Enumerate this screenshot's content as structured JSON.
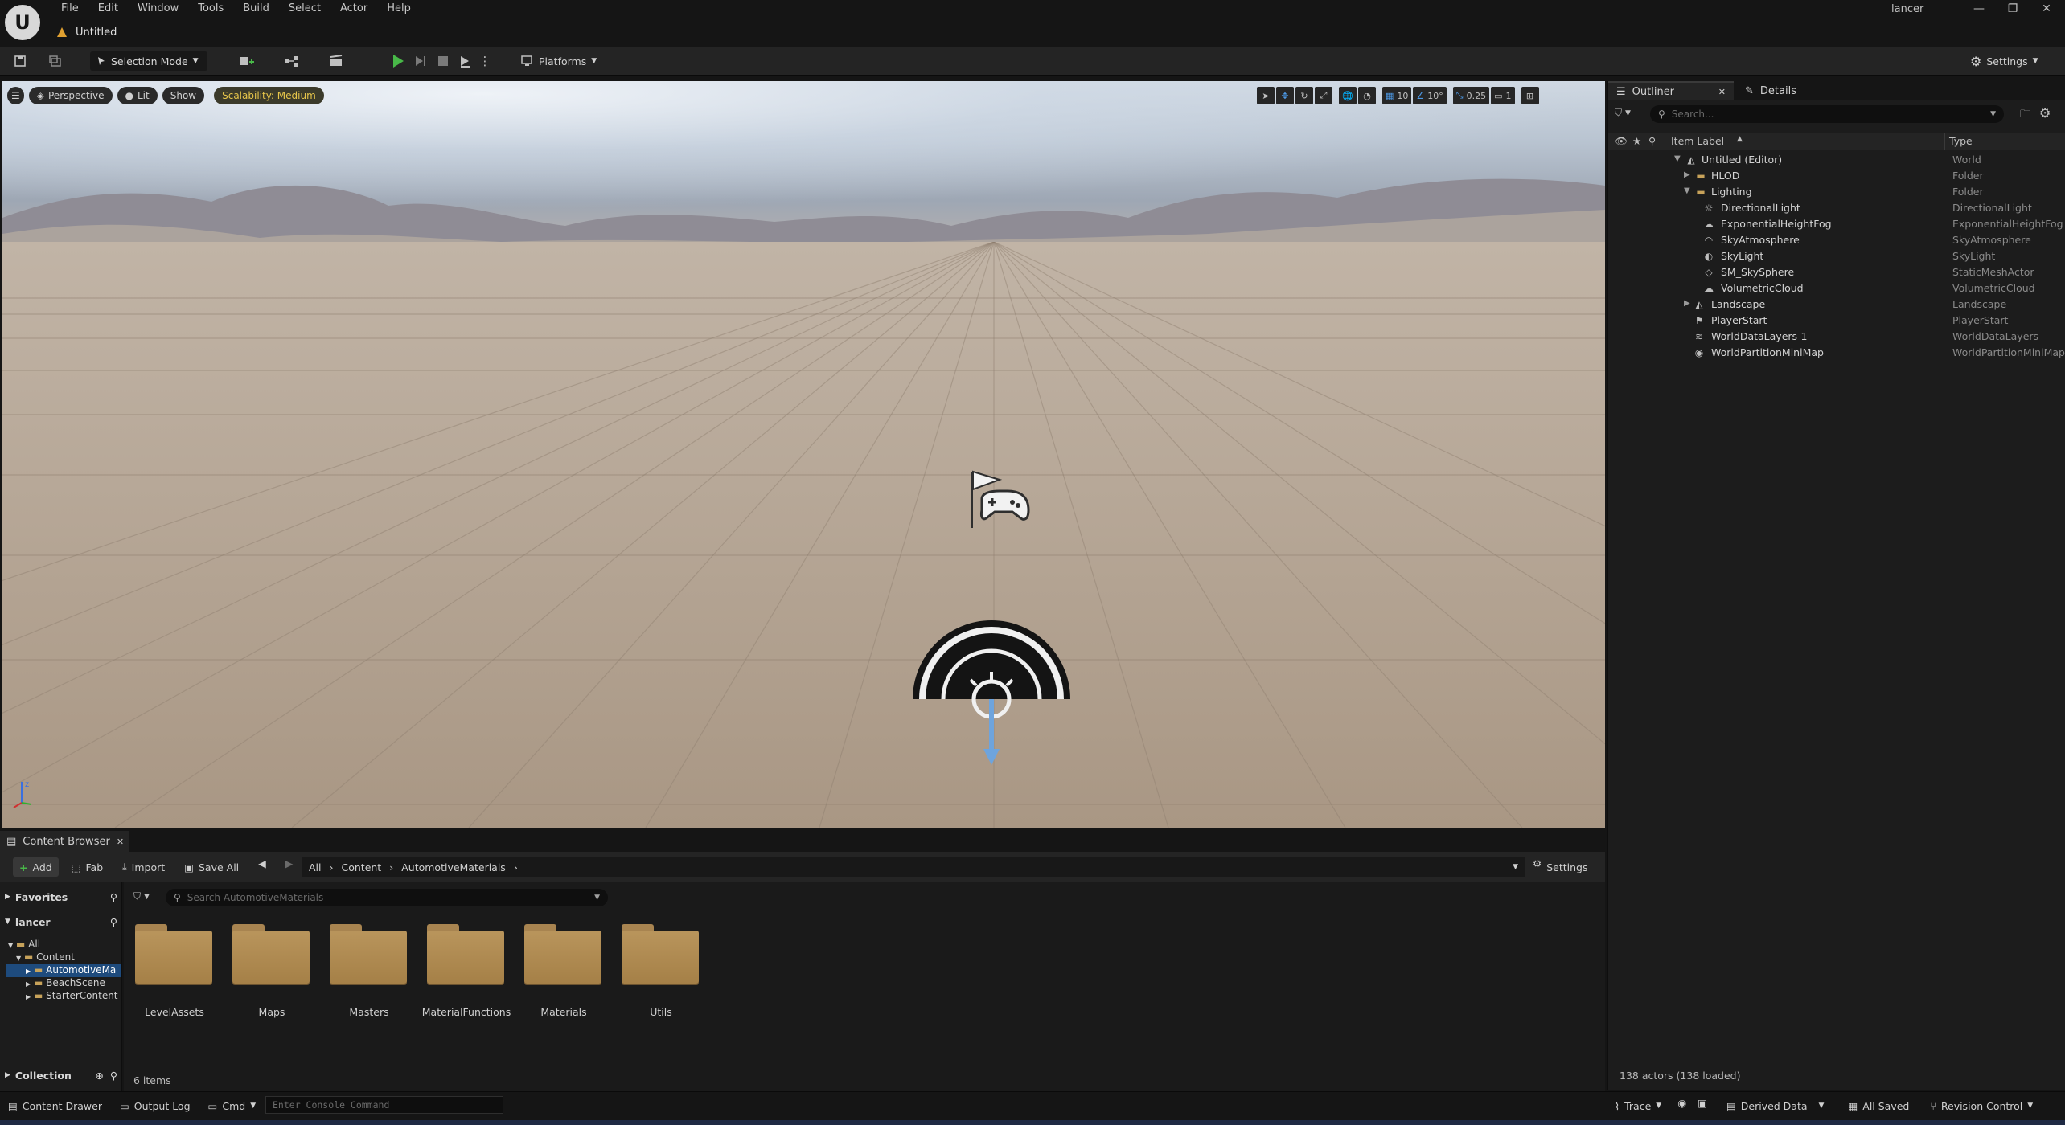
{
  "app": {
    "menu": [
      "File",
      "Edit",
      "Window",
      "Tools",
      "Build",
      "Select",
      "Actor",
      "Help"
    ],
    "doc_title": "Untitled",
    "user": "lancer",
    "window_controls": [
      "—",
      "❐",
      "✕"
    ]
  },
  "toolbar": {
    "selection_mode": "Selection Mode",
    "platforms": "Platforms",
    "settings": "Settings"
  },
  "viewport": {
    "perspective": "Perspective",
    "lit": "Lit",
    "show": "Show",
    "scalability": "Scalability: Medium",
    "grid_snap": "10",
    "rotation_snap": "10°",
    "scale_snap": "0.25",
    "camera_speed": "1"
  },
  "outliner": {
    "tab_outliner": "Outliner",
    "tab_details": "Details",
    "search_placeholder": "Search...",
    "col_label": "Item Label",
    "col_type": "Type",
    "rows": [
      {
        "label": "Untitled (Editor)",
        "type": "World"
      },
      {
        "label": "HLOD",
        "type": "Folder"
      },
      {
        "label": "Lighting",
        "type": "Folder"
      },
      {
        "label": "DirectionalLight",
        "type": "DirectionalLight"
      },
      {
        "label": "ExponentialHeightFog",
        "type": "ExponentialHeightFog"
      },
      {
        "label": "SkyAtmosphere",
        "type": "SkyAtmosphere"
      },
      {
        "label": "SkyLight",
        "type": "SkyLight"
      },
      {
        "label": "SM_SkySphere",
        "type": "StaticMeshActor"
      },
      {
        "label": "VolumetricCloud",
        "type": "VolumetricCloud"
      },
      {
        "label": "Landscape",
        "type": "Landscape"
      },
      {
        "label": "PlayerStart",
        "type": "PlayerStart"
      },
      {
        "label": "WorldDataLayers-1",
        "type": "WorldDataLayers"
      },
      {
        "label": "WorldPartitionMiniMap",
        "type": "WorldPartitionMiniMap"
      }
    ],
    "actor_count": "138 actors (138 loaded)"
  },
  "content_browser": {
    "tab": "Content Browser",
    "add": "Add",
    "fab": "Fab",
    "import": "Import",
    "save_all": "Save All",
    "breadcrumb": [
      "All",
      "Content",
      "AutomotiveMaterials"
    ],
    "settings": "Settings",
    "favorites": "Favorites",
    "user_section": "lancer",
    "tree": [
      "All",
      "Content",
      "AutomotiveMa",
      "BeachScene",
      "StarterContent"
    ],
    "collection": "Collection",
    "search_placeholder": "Search AutomotiveMaterials",
    "folders": [
      "LevelAssets",
      "Maps",
      "Masters",
      "MaterialFunctions",
      "Materials",
      "Utils"
    ],
    "item_count": "6 items"
  },
  "statusbar": {
    "content_drawer": "Content Drawer",
    "output_log": "Output Log",
    "cmd": "Cmd",
    "console_placeholder": "Enter Console Command",
    "trace": "Trace",
    "derived_data": "Derived Data",
    "all_saved": "All Saved",
    "revision_control": "Revision Control"
  },
  "colors": {
    "accent_blue": "#4d9ae8",
    "play_green": "#48b848",
    "scalability_yellow": "#e7c64b",
    "folder_tan": "#b9955c"
  }
}
